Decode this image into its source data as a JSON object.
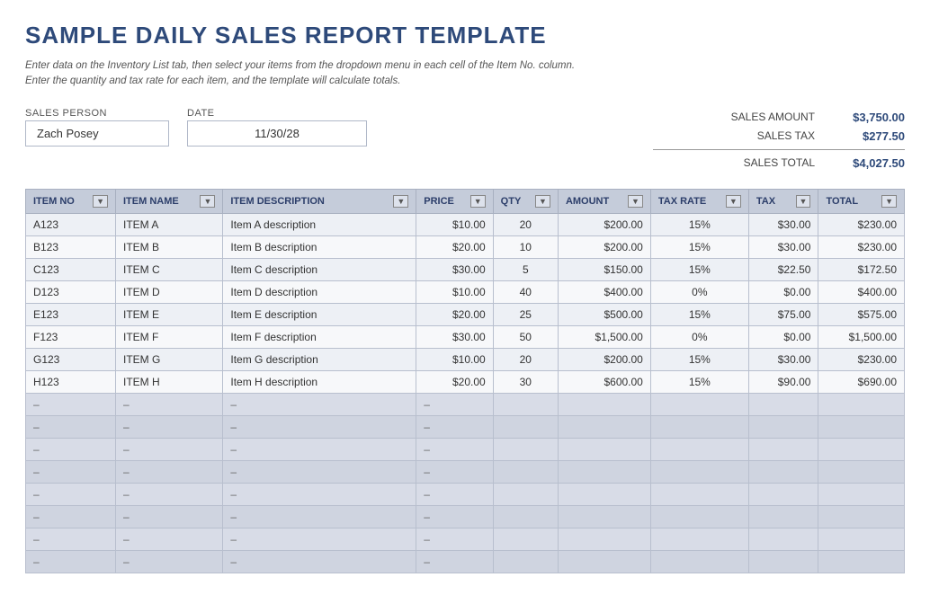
{
  "page": {
    "title": "SAMPLE DAILY SALES REPORT TEMPLATE",
    "subtitle_line1": "Enter data on the Inventory List tab, then select your items from the dropdown menu in each cell of the Item No. column.",
    "subtitle_line2": "Enter the quantity and tax rate for each item, and the template will calculate totals."
  },
  "form": {
    "sales_person_label": "SALES PERSON",
    "date_label": "DATE",
    "sales_person_value": "Zach Posey",
    "date_value": "11/30/28"
  },
  "summary": {
    "sales_amount_label": "SALES AMOUNT",
    "sales_amount_value": "$3,750.00",
    "sales_tax_label": "SALES TAX",
    "sales_tax_value": "$277.50",
    "sales_total_label": "SALES TOTAL",
    "sales_total_value": "$4,027.50"
  },
  "table": {
    "headers": [
      {
        "label": "ITEM NO",
        "key": "item_no"
      },
      {
        "label": "ITEM NAME",
        "key": "item_name"
      },
      {
        "label": "ITEM DESCRIPTION",
        "key": "item_desc"
      },
      {
        "label": "PRICE",
        "key": "price"
      },
      {
        "label": "QTY",
        "key": "qty"
      },
      {
        "label": "AMOUNT",
        "key": "amount"
      },
      {
        "label": "TAX RATE",
        "key": "tax_rate"
      },
      {
        "label": "TAX",
        "key": "tax"
      },
      {
        "label": "TOTAL",
        "key": "total"
      }
    ],
    "rows": [
      {
        "item_no": "A123",
        "item_name": "ITEM A",
        "item_desc": "Item A description",
        "price": "$10.00",
        "qty": "20",
        "amount": "$200.00",
        "tax_rate": "15%",
        "tax": "$30.00",
        "total": "$230.00"
      },
      {
        "item_no": "B123",
        "item_name": "ITEM B",
        "item_desc": "Item B description",
        "price": "$20.00",
        "qty": "10",
        "amount": "$200.00",
        "tax_rate": "15%",
        "tax": "$30.00",
        "total": "$230.00"
      },
      {
        "item_no": "C123",
        "item_name": "ITEM C",
        "item_desc": "Item C description",
        "price": "$30.00",
        "qty": "5",
        "amount": "$150.00",
        "tax_rate": "15%",
        "tax": "$22.50",
        "total": "$172.50"
      },
      {
        "item_no": "D123",
        "item_name": "ITEM D",
        "item_desc": "Item D description",
        "price": "$10.00",
        "qty": "40",
        "amount": "$400.00",
        "tax_rate": "0%",
        "tax": "$0.00",
        "total": "$400.00"
      },
      {
        "item_no": "E123",
        "item_name": "ITEM E",
        "item_desc": "Item E description",
        "price": "$20.00",
        "qty": "25",
        "amount": "$500.00",
        "tax_rate": "15%",
        "tax": "$75.00",
        "total": "$575.00"
      },
      {
        "item_no": "F123",
        "item_name": "ITEM F",
        "item_desc": "Item F description",
        "price": "$30.00",
        "qty": "50",
        "amount": "$1,500.00",
        "tax_rate": "0%",
        "tax": "$0.00",
        "total": "$1,500.00"
      },
      {
        "item_no": "G123",
        "item_name": "ITEM G",
        "item_desc": "Item G description",
        "price": "$10.00",
        "qty": "20",
        "amount": "$200.00",
        "tax_rate": "15%",
        "tax": "$30.00",
        "total": "$230.00"
      },
      {
        "item_no": "H123",
        "item_name": "ITEM H",
        "item_desc": "Item H description",
        "price": "$20.00",
        "qty": "30",
        "amount": "$600.00",
        "tax_rate": "15%",
        "tax": "$90.00",
        "total": "$690.00"
      }
    ],
    "empty_rows_count": 8
  }
}
